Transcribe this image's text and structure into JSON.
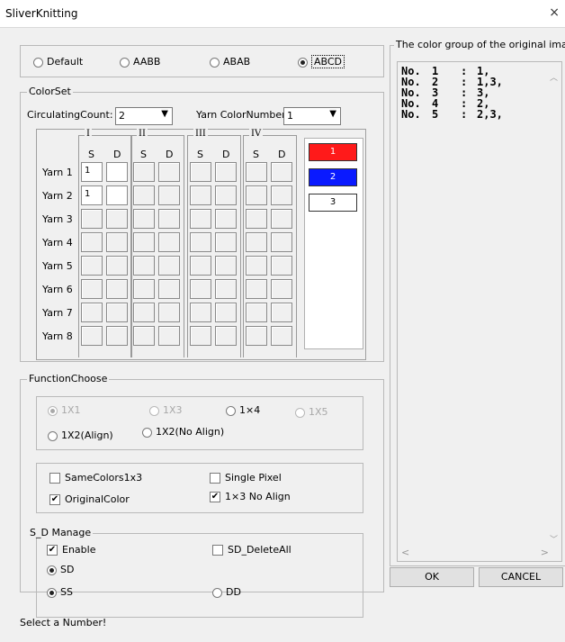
{
  "window": {
    "title": "SliverKnitting",
    "close_glyph": "×"
  },
  "pattern_modes": {
    "options": [
      "Default",
      "AABB",
      "ABAB",
      "ABCD"
    ],
    "selected": "ABCD"
  },
  "colorset": {
    "label": "ColorSet",
    "circulating_count_label": "CirculatingCount:",
    "circulating_count_value": "2",
    "yarn_color_number_label": "Yarn ColorNumber:",
    "yarn_color_number_value": "1",
    "groups": [
      "I",
      "II",
      "III",
      "IV"
    ],
    "col_headers": [
      "S",
      "D",
      "S",
      "D",
      "S",
      "D",
      "S",
      "D"
    ],
    "yarns": [
      "Yarn 1",
      "Yarn 2",
      "Yarn 3",
      "Yarn 4",
      "Yarn 5",
      "Yarn 6",
      "Yarn 7",
      "Yarn 8"
    ],
    "filled_cells": [
      {
        "row": 0,
        "col": 0,
        "value": "1"
      },
      {
        "row": 0,
        "col": 1,
        "value": ""
      },
      {
        "row": 1,
        "col": 0,
        "value": "1"
      },
      {
        "row": 1,
        "col": 1,
        "value": ""
      }
    ],
    "color_swatches": [
      {
        "label": "1",
        "color": "#ff1a1a",
        "text_color": "#ffffff"
      },
      {
        "label": "2",
        "color": "#0a1aff",
        "text_color": "#ffffff"
      },
      {
        "label": "3",
        "color": "#ffffff",
        "text_color": "#000000"
      }
    ]
  },
  "function_choose": {
    "label": "FunctionChoose",
    "opt_1x1": "1X1",
    "opt_1x3": "1X3",
    "opt_1x4": "1×4",
    "opt_1x5": "1X5",
    "opt_1x2_align": "1X2(Align)",
    "opt_1x2_noalign": "1X2(No Align)",
    "same_colors": "SameColors1x3",
    "single_pixel": "Single Pixel",
    "original_color": "OriginalColor",
    "no_align_1x3": "1×3 No Align"
  },
  "sd_manage": {
    "label": "S_D Manage",
    "enable": "Enable",
    "delete_all": "SD_DeleteAll",
    "sd": "SD",
    "ss": "SS",
    "dd": "DD"
  },
  "status_text": "Select a Number!",
  "original_colors": {
    "label": "The color group of the original image",
    "rows": [
      {
        "no": "No.",
        "idx": "1",
        "sep": ":",
        "val": "1,"
      },
      {
        "no": "No.",
        "idx": "2",
        "sep": ":",
        "val": "1,3,"
      },
      {
        "no": "No.",
        "idx": "3",
        "sep": ":",
        "val": "3,"
      },
      {
        "no": "No.",
        "idx": "4",
        "sep": ":",
        "val": "2,"
      },
      {
        "no": "No.",
        "idx": "5",
        "sep": ":",
        "val": "2,3,"
      }
    ]
  },
  "buttons": {
    "ok": "OK",
    "cancel": "CANCEL"
  }
}
